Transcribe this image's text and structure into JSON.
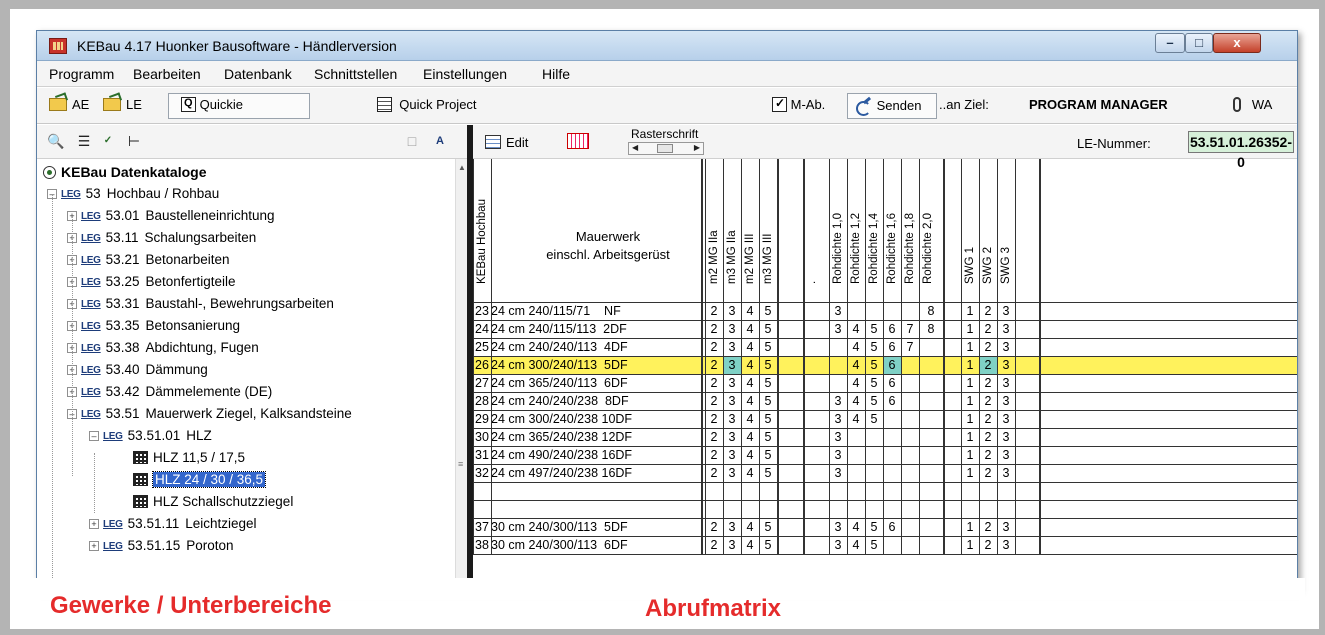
{
  "window": {
    "title": "KEBau 4.17   Huonker Bausoftware - Händlerversion",
    "controls": {
      "minimize": "–",
      "maximize": "□",
      "close": "x"
    }
  },
  "menu": [
    "Programm",
    "Bearbeiten",
    "Datenbank",
    "Schnittstellen",
    "Einstellungen",
    "Hilfe"
  ],
  "toolbar": {
    "ae": "AE",
    "le": "LE",
    "quickie": "Quickie",
    "quick_project": "Quick Project",
    "m_ab": "M-Ab.",
    "senden": "Senden",
    "an_ziel": "..an Ziel:",
    "target": "PROGRAM MANAGER",
    "wa": "WA"
  },
  "left_toolbar": {
    "icons": [
      "binoculars-icon",
      "list-icon",
      "spellcheck-icon",
      "tree-icon",
      "page-icon",
      "font-icon"
    ],
    "font_label": "A"
  },
  "tree": {
    "root": "KEBau Datenkataloge",
    "leg_tag": "LEG",
    "nodes": [
      {
        "code": "53",
        "label": "Hochbau / Rohbau",
        "level": 0,
        "toggle": "–"
      },
      {
        "code": "53.01",
        "label": "Baustelleneinrichtung",
        "level": 1,
        "toggle": "+"
      },
      {
        "code": "53.11",
        "label": "Schalungsarbeiten",
        "level": 1,
        "toggle": "+"
      },
      {
        "code": "53.21",
        "label": "Betonarbeiten",
        "level": 1,
        "toggle": "+"
      },
      {
        "code": "53.25",
        "label": "Betonfertigteile",
        "level": 1,
        "toggle": "+"
      },
      {
        "code": "53.31",
        "label": "Baustahl-, Bewehrungsarbeiten",
        "level": 1,
        "toggle": "+"
      },
      {
        "code": "53.35",
        "label": "Betonsanierung",
        "level": 1,
        "toggle": "+"
      },
      {
        "code": "53.38",
        "label": "Abdichtung, Fugen",
        "level": 1,
        "toggle": "+"
      },
      {
        "code": "53.40",
        "label": "Dämmung",
        "level": 1,
        "toggle": "+"
      },
      {
        "code": "53.42",
        "label": "Dämmelemente (DE)",
        "level": 1,
        "toggle": "+"
      },
      {
        "code": "53.51",
        "label": "Mauerwerk Ziegel, Kalksandsteine",
        "level": 1,
        "toggle": "–"
      },
      {
        "code": "53.51.01",
        "label": "HLZ",
        "level": 2,
        "toggle": "–"
      }
    ],
    "leaves": [
      "HLZ 11,5 / 17,5",
      "HLZ 24 / 30 / 36,5",
      "HLZ Schallschutzziegel"
    ],
    "selected_leaf": 1,
    "more_nodes": [
      {
        "code": "53.51.11",
        "label": "Leichtziegel",
        "toggle": "+"
      },
      {
        "code": "53.51.15",
        "label": "Poroton",
        "toggle": "+"
      }
    ]
  },
  "right_toolbar": {
    "edit": "Edit",
    "rasterschrift": "Rasterschrift",
    "le_nummer_label": "LE-Nummer:",
    "le_nummer": "53.51.01.26352-0"
  },
  "matrix": {
    "first_col_header": "KEBau Hochbau",
    "desc_header_1": "Mauerwerk",
    "desc_header_2": "einschl. Arbeitsgerüst",
    "columns": [
      "m2 MG IIa",
      "m3 MG IIa",
      "m2 MG III",
      "m3 MG III",
      "",
      ".",
      "Rohdichte 1,0",
      "Rohdichte 1,2",
      "Rohdichte 1,4",
      "Rohdichte 1,6",
      "Rohdichte 1,8",
      "Rohdichte 2,0",
      "",
      "SWG 1",
      "SWG 2",
      "SWG 3",
      ""
    ],
    "highlight_row": 3,
    "rows": [
      {
        "no": "23",
        "desc": "24 cm 240/115/71    NF",
        "cells": [
          "2",
          "3",
          "4",
          "5",
          "",
          "",
          "3",
          "",
          "",
          "",
          "",
          "8",
          "",
          "1",
          "2",
          "3",
          ""
        ]
      },
      {
        "no": "24",
        "desc": "24 cm 240/115/113  2DF",
        "cells": [
          "2",
          "3",
          "4",
          "5",
          "",
          "",
          "3",
          "4",
          "5",
          "6",
          "7",
          "8",
          "",
          "1",
          "2",
          "3",
          ""
        ]
      },
      {
        "no": "25",
        "desc": "24 cm 240/240/113  4DF",
        "cells": [
          "2",
          "3",
          "4",
          "5",
          "",
          "",
          "",
          "4",
          "5",
          "6",
          "7",
          "",
          "",
          "1",
          "2",
          "3",
          ""
        ]
      },
      {
        "no": "26",
        "desc": "24 cm 300/240/113  5DF",
        "cells": [
          "2",
          "3",
          "4",
          "5",
          "",
          "",
          "",
          "4",
          "5",
          "6",
          "",
          "",
          "",
          "1",
          "2",
          "3",
          ""
        ]
      },
      {
        "no": "27",
        "desc": "24 cm 365/240/113  6DF",
        "cells": [
          "2",
          "3",
          "4",
          "5",
          "",
          "",
          "",
          "4",
          "5",
          "6",
          "",
          "",
          "",
          "1",
          "2",
          "3",
          ""
        ]
      },
      {
        "no": "28",
        "desc": "24 cm 240/240/238  8DF",
        "cells": [
          "2",
          "3",
          "4",
          "5",
          "",
          "",
          "3",
          "4",
          "5",
          "6",
          "",
          "",
          "",
          "1",
          "2",
          "3",
          ""
        ]
      },
      {
        "no": "29",
        "desc": "24 cm 300/240/238 10DF",
        "cells": [
          "2",
          "3",
          "4",
          "5",
          "",
          "",
          "3",
          "4",
          "5",
          "",
          "",
          "",
          "",
          "1",
          "2",
          "3",
          ""
        ]
      },
      {
        "no": "30",
        "desc": "24 cm 365/240/238 12DF",
        "cells": [
          "2",
          "3",
          "4",
          "5",
          "",
          "",
          "3",
          "",
          "",
          "",
          "",
          "",
          "",
          "1",
          "2",
          "3",
          ""
        ]
      },
      {
        "no": "31",
        "desc": "24 cm 490/240/238 16DF",
        "cells": [
          "2",
          "3",
          "4",
          "5",
          "",
          "",
          "3",
          "",
          "",
          "",
          "",
          "",
          "",
          "1",
          "2",
          "3",
          ""
        ]
      },
      {
        "no": "32",
        "desc": "24 cm 497/240/238 16DF",
        "cells": [
          "2",
          "3",
          "4",
          "5",
          "",
          "",
          "3",
          "",
          "",
          "",
          "",
          "",
          "",
          "1",
          "2",
          "3",
          ""
        ]
      },
      {
        "no": "",
        "desc": "",
        "cells": [
          "",
          "",
          "",
          "",
          "",
          "",
          "",
          "",
          "",
          "",
          "",
          "",
          "",
          "",
          "",
          "",
          ""
        ]
      },
      {
        "no": "",
        "desc": "",
        "cells": [
          "",
          "",
          "",
          "",
          "",
          "",
          "",
          "",
          "",
          "",
          "",
          "",
          "",
          "",
          "",
          "",
          ""
        ]
      },
      {
        "no": "37",
        "desc": "30 cm 240/300/113  5DF",
        "cells": [
          "2",
          "3",
          "4",
          "5",
          "",
          "",
          "3",
          "4",
          "5",
          "6",
          "",
          "",
          "",
          "1",
          "2",
          "3",
          ""
        ]
      },
      {
        "no": "38",
        "desc": "30 cm 240/300/113  6DF",
        "cells": [
          "2",
          "3",
          "4",
          "5",
          "",
          "",
          "3",
          "4",
          "5",
          "",
          "",
          "",
          "",
          "1",
          "2",
          "3",
          ""
        ]
      }
    ]
  },
  "captions": {
    "left": "Gewerke / Unterbereiche",
    "right": "Abrufmatrix"
  },
  "colors": {
    "caption": "#e52b2b",
    "highlight": "#fff25c",
    "highlight_cell": "#7fd1c5",
    "le_box": "#d6f0d9",
    "selection": "#3366cc"
  }
}
